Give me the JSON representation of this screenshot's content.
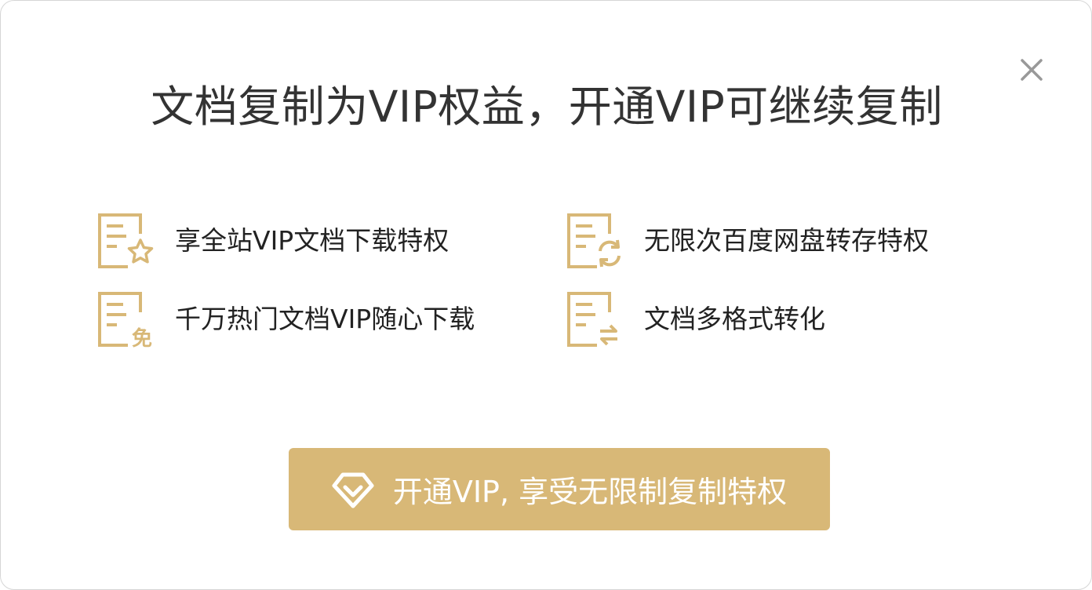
{
  "dialog": {
    "title": "文档复制为VIP权益，开通VIP可继续复制",
    "close_icon": "close-icon"
  },
  "features": [
    {
      "label": "享全站VIP文档下载特权",
      "icon": "document-star-icon"
    },
    {
      "label": "无限次百度网盘转存特权",
      "icon": "document-sync-icon"
    },
    {
      "label": "千万热门文档VIP随心下载",
      "icon": "document-free-icon",
      "badge": "免"
    },
    {
      "label": "文档多格式转化",
      "icon": "document-convert-icon"
    }
  ],
  "cta": {
    "label": "开通VIP, 享受无限制复制特权",
    "icon": "diamond-icon"
  },
  "colors": {
    "accent": "#d8b877",
    "title_text": "#333333",
    "body_text": "#222222",
    "close_icon": "#999999"
  }
}
